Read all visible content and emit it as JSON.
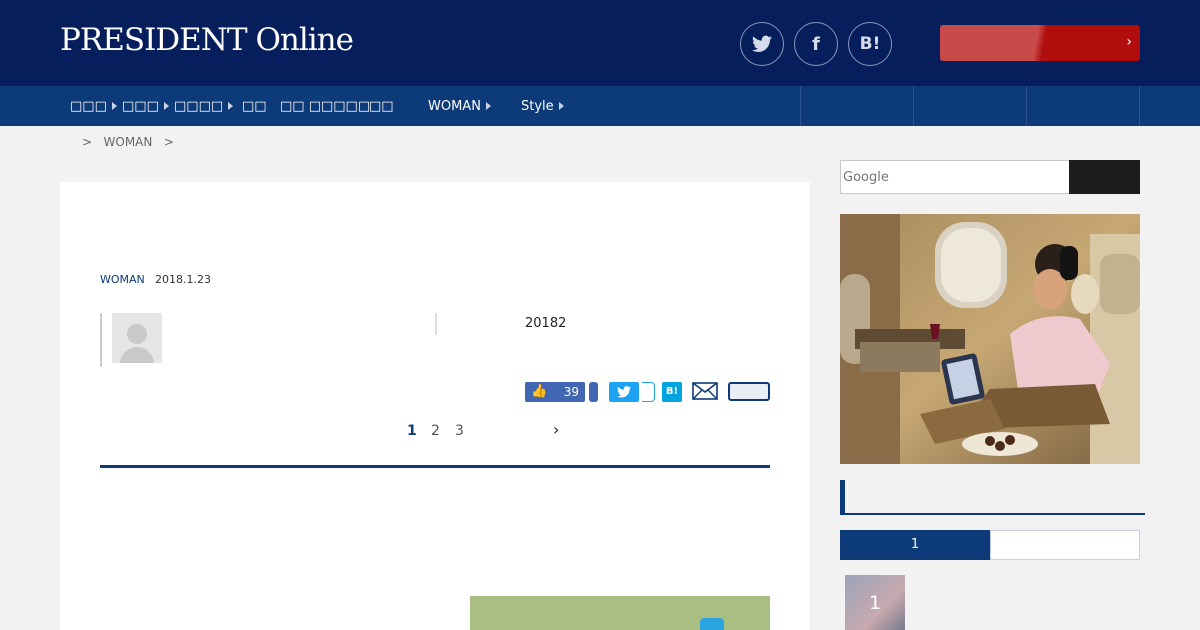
{
  "header": {
    "logo_text": "PRESIDENT Online",
    "social": [
      {
        "icon": "twitter-icon",
        "glyph": "🐦"
      },
      {
        "icon": "facebook-icon",
        "glyph": "f"
      },
      {
        "icon": "hatena-bookmark-icon",
        "glyph": "B!"
      }
    ],
    "cta_chevron": "›"
  },
  "nav": {
    "items": [
      {
        "label": "□□□"
      },
      {
        "label": "□□□"
      },
      {
        "label": "□□□□"
      },
      {
        "label": "□□"
      },
      {
        "label": "□□ □□□□□"
      },
      {
        "label": "□□"
      },
      {
        "label": "WOMAN"
      },
      {
        "label": "Style"
      }
    ]
  },
  "breadcrumb": {
    "sep1": ">",
    "category": "WOMAN",
    "sep2": ">"
  },
  "article": {
    "category": "WOMAN",
    "date": "2018.1.23",
    "year_text": "20182",
    "like_count": "39",
    "hatena_label": "B!",
    "pages": [
      "1",
      "2",
      "3"
    ],
    "active_page": "1",
    "next_glyph": "›"
  },
  "sidebar": {
    "search_placeholder": "Google",
    "ranking_tab_label": "1",
    "rank_item_number": "1"
  },
  "colors": {
    "header_bg": "#061f5c",
    "nav_bg": "#0d3a78",
    "accent_red": "#b10d0d",
    "facebook_blue": "#4267b2",
    "twitter_blue": "#1da1f2"
  }
}
